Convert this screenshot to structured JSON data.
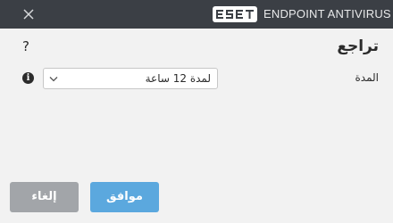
{
  "titlebar": {
    "logo_text": "ESET",
    "product_name": "ENDPOINT ANTIVIRUS",
    "close_icon": "close-icon"
  },
  "page": {
    "title": "تراجع",
    "help_icon": "?"
  },
  "duration": {
    "label": "المدة",
    "selected_value": "لمدة 12 ساعة",
    "info_icon": "i"
  },
  "buttons": {
    "ok_label": "موافق",
    "cancel_label": "إلغاء"
  },
  "colors": {
    "titlebar_bg": "#3b3f45",
    "ok_button": "#5ba8de",
    "cancel_button": "#a2a5a9",
    "brand_logo_box": "#ffffff"
  }
}
